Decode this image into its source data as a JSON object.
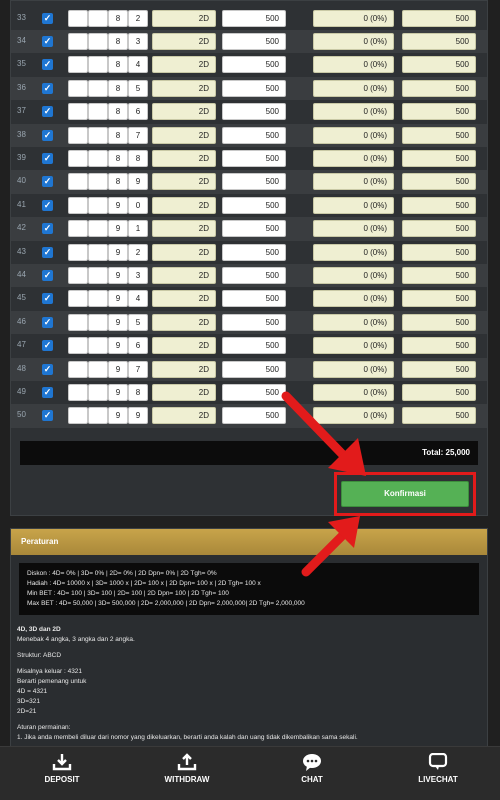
{
  "bet_rows": [
    {
      "no": "33",
      "d3": "8",
      "d4": "2",
      "game": "2D",
      "bet": "500",
      "discount": "0 (0%)",
      "pay": "500"
    },
    {
      "no": "34",
      "d3": "8",
      "d4": "3",
      "game": "2D",
      "bet": "500",
      "discount": "0 (0%)",
      "pay": "500"
    },
    {
      "no": "35",
      "d3": "8",
      "d4": "4",
      "game": "2D",
      "bet": "500",
      "discount": "0 (0%)",
      "pay": "500"
    },
    {
      "no": "36",
      "d3": "8",
      "d4": "5",
      "game": "2D",
      "bet": "500",
      "discount": "0 (0%)",
      "pay": "500"
    },
    {
      "no": "37",
      "d3": "8",
      "d4": "6",
      "game": "2D",
      "bet": "500",
      "discount": "0 (0%)",
      "pay": "500"
    },
    {
      "no": "38",
      "d3": "8",
      "d4": "7",
      "game": "2D",
      "bet": "500",
      "discount": "0 (0%)",
      "pay": "500"
    },
    {
      "no": "39",
      "d3": "8",
      "d4": "8",
      "game": "2D",
      "bet": "500",
      "discount": "0 (0%)",
      "pay": "500"
    },
    {
      "no": "40",
      "d3": "8",
      "d4": "9",
      "game": "2D",
      "bet": "500",
      "discount": "0 (0%)",
      "pay": "500"
    },
    {
      "no": "41",
      "d3": "9",
      "d4": "0",
      "game": "2D",
      "bet": "500",
      "discount": "0 (0%)",
      "pay": "500"
    },
    {
      "no": "42",
      "d3": "9",
      "d4": "1",
      "game": "2D",
      "bet": "500",
      "discount": "0 (0%)",
      "pay": "500"
    },
    {
      "no": "43",
      "d3": "9",
      "d4": "2",
      "game": "2D",
      "bet": "500",
      "discount": "0 (0%)",
      "pay": "500"
    },
    {
      "no": "44",
      "d3": "9",
      "d4": "3",
      "game": "2D",
      "bet": "500",
      "discount": "0 (0%)",
      "pay": "500"
    },
    {
      "no": "45",
      "d3": "9",
      "d4": "4",
      "game": "2D",
      "bet": "500",
      "discount": "0 (0%)",
      "pay": "500"
    },
    {
      "no": "46",
      "d3": "9",
      "d4": "5",
      "game": "2D",
      "bet": "500",
      "discount": "0 (0%)",
      "pay": "500"
    },
    {
      "no": "47",
      "d3": "9",
      "d4": "6",
      "game": "2D",
      "bet": "500",
      "discount": "0 (0%)",
      "pay": "500"
    },
    {
      "no": "48",
      "d3": "9",
      "d4": "7",
      "game": "2D",
      "bet": "500",
      "discount": "0 (0%)",
      "pay": "500"
    },
    {
      "no": "49",
      "d3": "9",
      "d4": "8",
      "game": "2D",
      "bet": "500",
      "discount": "0 (0%)",
      "pay": "500"
    },
    {
      "no": "50",
      "d3": "9",
      "d4": "9",
      "game": "2D",
      "bet": "500",
      "discount": "0 (0%)",
      "pay": "500"
    }
  ],
  "check_mark": "✓",
  "total_label": "Total: 25,000",
  "confirm_label": "Konfirmasi",
  "rules": {
    "title": "Peraturan",
    "box_lines": [
      "Diskon : 4D= 0% | 3D= 0% | 2D= 0% | 2D Dpn= 0% | 2D Tgh= 0%",
      "Hadiah : 4D= 10000 x | 3D= 1000 x | 2D= 100 x | 2D Dpn= 100 x | 2D Tgh= 100 x",
      "Min BET : 4D= 100 | 3D= 100 | 2D= 100 | 2D Dpn= 100 | 2D Tgh= 100",
      "Max BET : 4D= 50,000 | 3D= 500,000 | 2D= 2,000,000 | 2D Dpn= 2,000,000| 2D Tgh= 2,000,000"
    ],
    "heading": "4D, 3D dan 2D",
    "desc": "Menebak 4 angka, 3 angka dan 2 angka.",
    "structure": "Struktur: ABCD",
    "example_lines": [
      "Misalnya keluar : 4321",
      "Berarti pemenang untuk",
      "4D = 4321",
      "3D=321",
      "2D=21"
    ],
    "rules_title": "Aturan permainan:",
    "rule_1": "1. Jika anda membeli diluar dari nomor yang dikeluarkan, berarti anda kalah dan uang tidak dikembalikan sama sekali."
  },
  "nav": [
    {
      "label": "DEPOSIT",
      "icon": "download-icon"
    },
    {
      "label": "WITHDRAW",
      "icon": "upload-icon"
    },
    {
      "label": "CHAT",
      "icon": "chat-icon"
    },
    {
      "label": "LIVECHAT",
      "icon": "livechat-icon"
    }
  ],
  "colors": {
    "accent_red": "#e21b1b",
    "confirm_green": "#55b155",
    "rules_gold": "#b8953f",
    "checkbox_blue": "#1f76d2"
  }
}
